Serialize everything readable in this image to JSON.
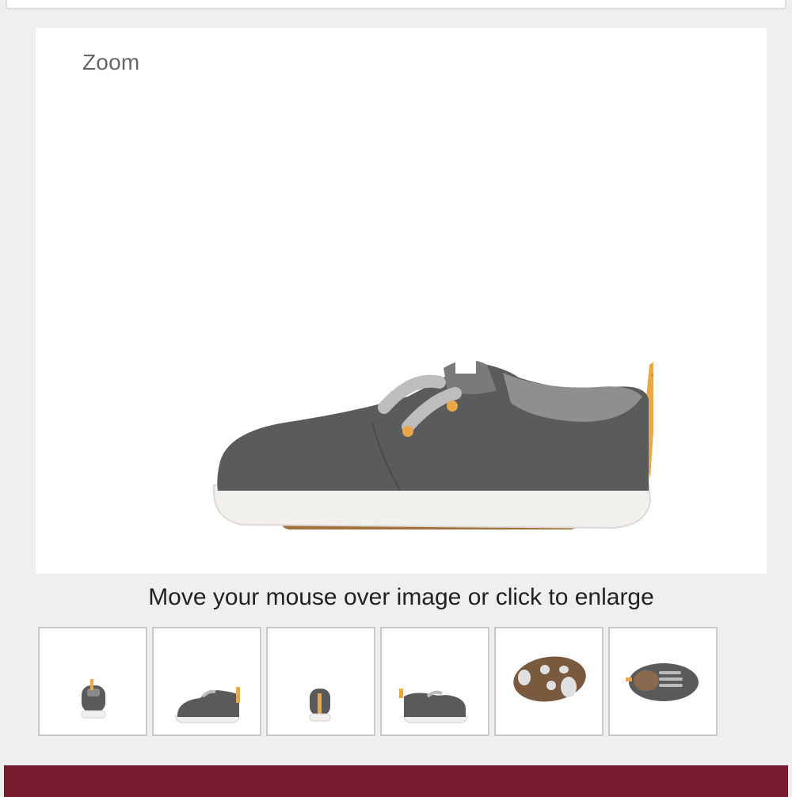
{
  "gallery": {
    "zoom_label": "Zoom",
    "hint_text": "Move your mouse over image or click to enlarge",
    "main_image": {
      "alt": "Dark gray felt toddler sneaker with white sole and orange pull tab, side view"
    },
    "thumbnails": [
      {
        "view": "front"
      },
      {
        "view": "outer-side"
      },
      {
        "view": "back"
      },
      {
        "view": "inner-side"
      },
      {
        "view": "sole"
      },
      {
        "view": "top"
      }
    ]
  },
  "colors": {
    "felt": "#5a5a5a",
    "sole": "#f2f0ec",
    "pull_tab": "#e8a84a",
    "accent_bar": "#7a1a2e"
  }
}
